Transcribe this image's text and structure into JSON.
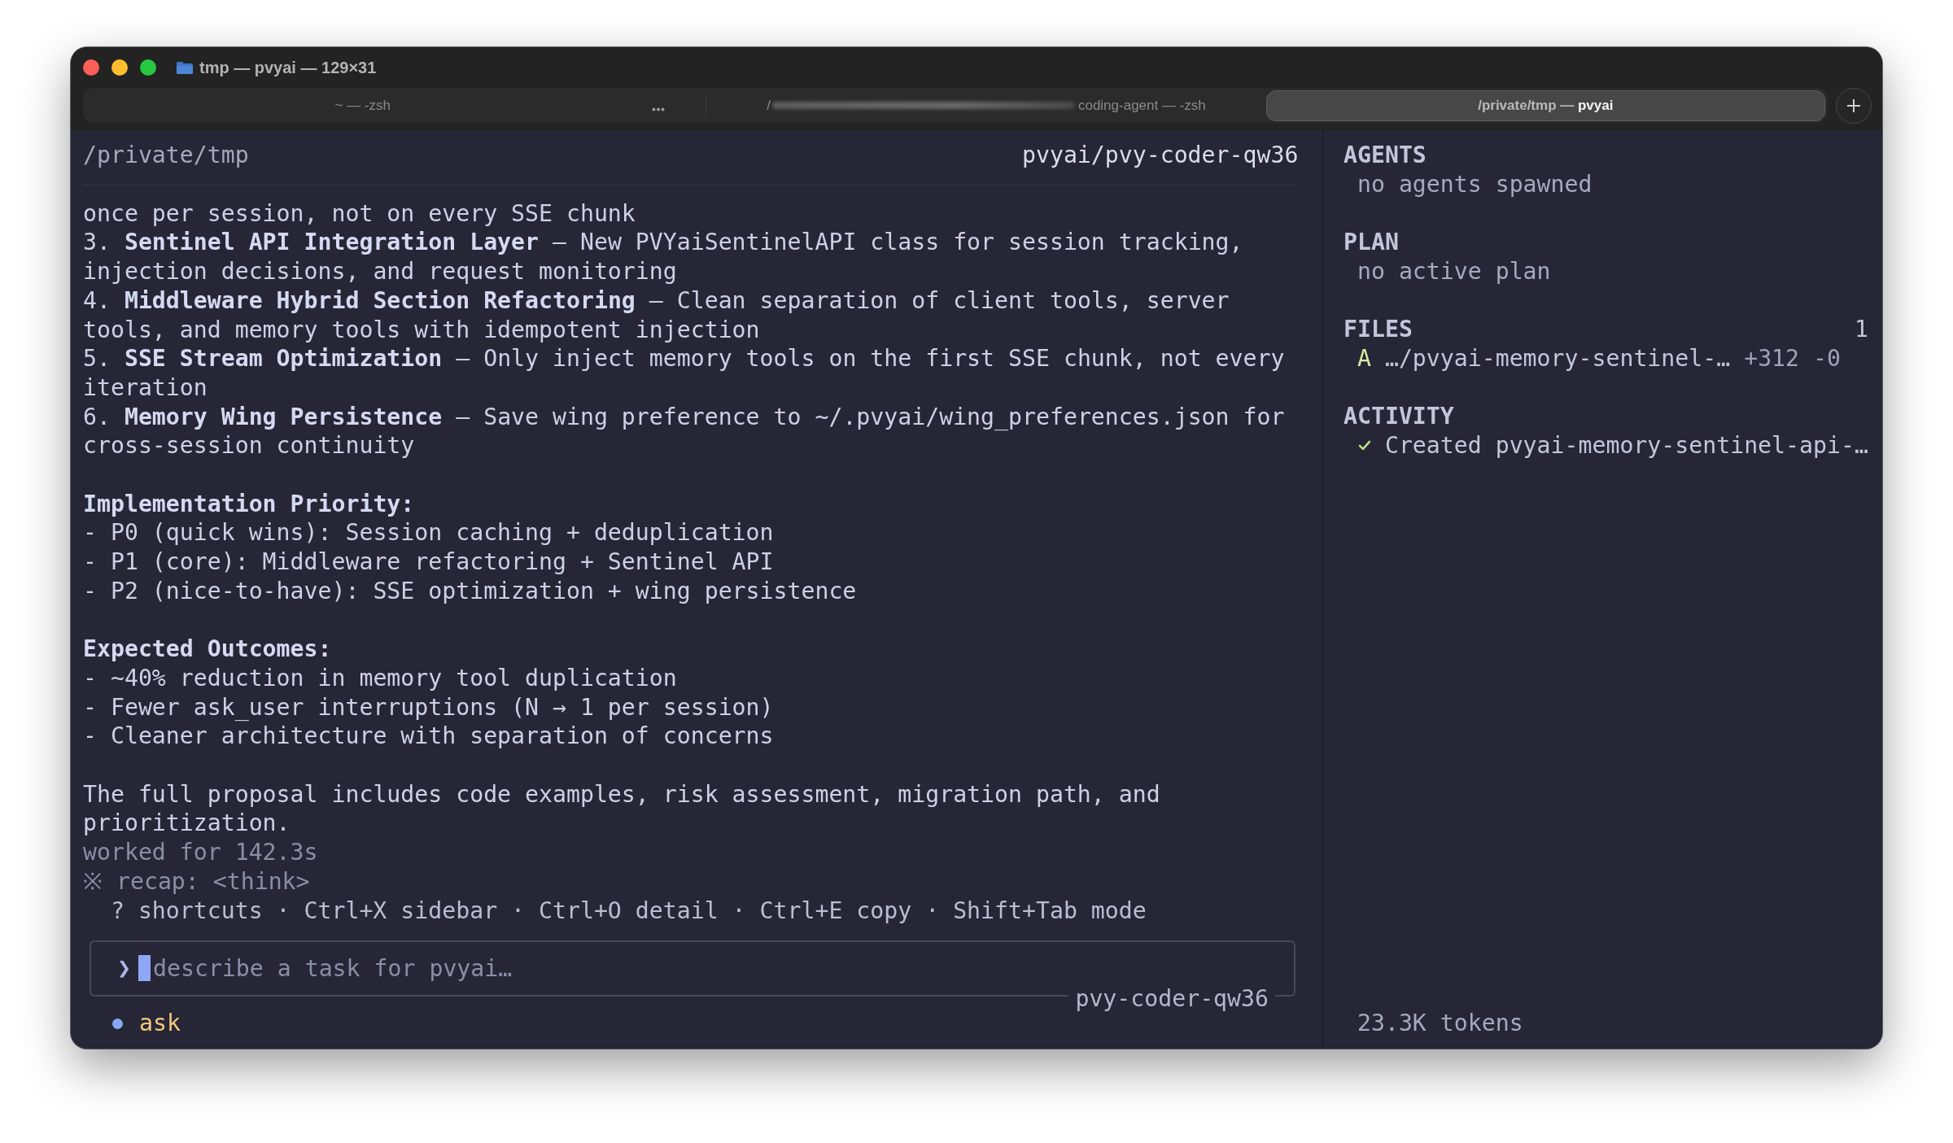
{
  "window": {
    "title": "tmp — pvyai — 129×31"
  },
  "tabs": [
    {
      "label": "~ — -zsh",
      "selected": false
    },
    {
      "prefix": "/",
      "redacted": true,
      "label": "coding-agent — -zsh",
      "selected": false
    },
    {
      "label": "/private/tmp — **pvyai**",
      "selected": true
    }
  ],
  "pane": {
    "path": "/private/tmp",
    "model": "pvyai/pvy-coder-qw36"
  },
  "transcript": [
    [
      {
        "kind": "text",
        "text": "once per session, not on every SSE chunk"
      },
      {
        "kind": "text",
        "text": "3. **Sentinel API Integration Layer** — New PVYaiSentinelAPI class for session tracking, injection decisions, and request monitoring"
      },
      {
        "kind": "text",
        "text": "4. **Middleware Hybrid Section Refactoring** — Clean separation of client tools, server tools, and memory tools with idempotent injection"
      },
      {
        "kind": "text",
        "text": "5. **SSE Stream Optimization** — Only inject memory tools on the first SSE chunk, not every iteration"
      },
      {
        "kind": "text",
        "text": "6. **Memory Wing Persistence** — Save wing preference to ~/.pvyai/wing_preferences.json for cross-session continuity"
      }
    ],
    [
      {
        "kind": "heading",
        "text": "Implementation Priority:"
      },
      {
        "kind": "text",
        "text": "- P0 (quick wins): Session caching + deduplication"
      },
      {
        "kind": "text",
        "text": "- P1 (core): Middleware refactoring + Sentinel API"
      },
      {
        "kind": "text",
        "text": "- P2 (nice-to-have): SSE optimization + wing persistence"
      }
    ],
    [
      {
        "kind": "heading",
        "text": "Expected Outcomes:"
      },
      {
        "kind": "text",
        "text": "- ~40% reduction in memory tool duplication"
      },
      {
        "kind": "text",
        "text": "- Fewer ask_user interruptions (N → 1 per session)"
      },
      {
        "kind": "text",
        "text": "- Cleaner architecture with separation of concerns"
      }
    ],
    [
      {
        "kind": "text",
        "text": "The full proposal includes code examples, risk assessment, migration path, and prioritization."
      },
      {
        "kind": "meta",
        "text": "worked for 142.3s"
      },
      {
        "kind": "meta",
        "text": "※ recap: <think>"
      }
    ]
  ],
  "shortcuts_hint": "? shortcuts · Ctrl+X sidebar · Ctrl+O detail · Ctrl+E copy · Shift+Tab mode",
  "input": {
    "prompt": "❯",
    "placeholder": "describe a task for pvyai…",
    "model": "pvy-coder-qw36"
  },
  "status": {
    "mode": "ask"
  },
  "sidebar": {
    "sections": [
      {
        "kind": "note",
        "title": "AGENTS",
        "text": "no agents spawned"
      },
      {
        "kind": "note",
        "title": "PLAN",
        "text": "no active plan"
      },
      {
        "kind": "files",
        "title": "FILES",
        "count": "1",
        "files": [
          {
            "status": "A",
            "path": "…/pvyai-memory-sentinel-…",
            "diff": "+312 -0"
          }
        ]
      },
      {
        "kind": "activity",
        "title": "ACTIVITY",
        "events": [
          {
            "done": true,
            "text": "Created pvyai-memory-sentinel-api-…"
          }
        ]
      }
    ],
    "tokens": "23.3K tokens"
  }
}
